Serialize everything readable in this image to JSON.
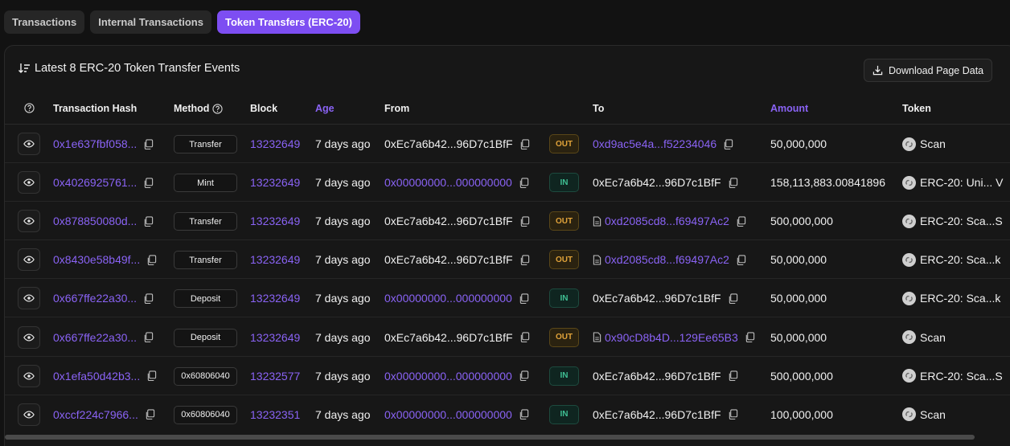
{
  "tabs": [
    {
      "label": "Transactions",
      "active": false
    },
    {
      "label": "Internal Transactions",
      "active": false
    },
    {
      "label": "Token Transfers (ERC-20)",
      "active": true
    }
  ],
  "card": {
    "title": "Latest 8 ERC-20 Token Transfer Events",
    "download_label": "Download Page Data"
  },
  "columns": {
    "tx_hash": "Transaction Hash",
    "method": "Method",
    "block": "Block",
    "age": "Age",
    "from": "From",
    "to": "To",
    "amount": "Amount",
    "token": "Token"
  },
  "rows": [
    {
      "hash": "0x1e637fbf058...",
      "method": "Transfer",
      "block": "13232649",
      "age": "7 days ago",
      "from": "0xEc7a6b42...96D7c1BfF",
      "from_link": false,
      "dir": "OUT",
      "to": "0xd9ac5e4a...f52234046",
      "to_link": true,
      "to_contract": false,
      "amount": "50,000,000",
      "token": "Scan"
    },
    {
      "hash": "0x4026925761...",
      "method": "Mint",
      "block": "13232649",
      "age": "7 days ago",
      "from": "0x00000000...000000000",
      "from_link": true,
      "dir": "IN",
      "to": "0xEc7a6b42...96D7c1BfF",
      "to_link": false,
      "to_contract": false,
      "amount": "158,113,883.00841896",
      "token": "ERC-20: Uni... V"
    },
    {
      "hash": "0x878850080d...",
      "method": "Transfer",
      "block": "13232649",
      "age": "7 days ago",
      "from": "0xEc7a6b42...96D7c1BfF",
      "from_link": false,
      "dir": "OUT",
      "to": "0xd2085cd8...f69497Ac2",
      "to_link": true,
      "to_contract": true,
      "amount": "500,000,000",
      "token": "ERC-20: Sca...S"
    },
    {
      "hash": "0x8430e58b49f...",
      "method": "Transfer",
      "block": "13232649",
      "age": "7 days ago",
      "from": "0xEc7a6b42...96D7c1BfF",
      "from_link": false,
      "dir": "OUT",
      "to": "0xd2085cd8...f69497Ac2",
      "to_link": true,
      "to_contract": true,
      "amount": "50,000,000",
      "token": "ERC-20: Sca...k"
    },
    {
      "hash": "0x667ffe22a30...",
      "method": "Deposit",
      "block": "13232649",
      "age": "7 days ago",
      "from": "0x00000000...000000000",
      "from_link": true,
      "dir": "IN",
      "to": "0xEc7a6b42...96D7c1BfF",
      "to_link": false,
      "to_contract": false,
      "amount": "50,000,000",
      "token": "ERC-20: Sca...k"
    },
    {
      "hash": "0x667ffe22a30...",
      "method": "Deposit",
      "block": "13232649",
      "age": "7 days ago",
      "from": "0xEc7a6b42...96D7c1BfF",
      "from_link": false,
      "dir": "OUT",
      "to": "0x90cD8b4D...129Ee65B3",
      "to_link": true,
      "to_contract": true,
      "amount": "50,000,000",
      "token": "Scan"
    },
    {
      "hash": "0x1efa50d42b3...",
      "method": "0x60806040",
      "block": "13232577",
      "age": "7 days ago",
      "from": "0x00000000...000000000",
      "from_link": true,
      "dir": "IN",
      "to": "0xEc7a6b42...96D7c1BfF",
      "to_link": false,
      "to_contract": false,
      "amount": "500,000,000",
      "token": "ERC-20: Sca...S"
    },
    {
      "hash": "0xccf224c7966...",
      "method": "0x60806040",
      "block": "13232351",
      "age": "7 days ago",
      "from": "0x00000000...000000000",
      "from_link": true,
      "dir": "IN",
      "to": "0xEc7a6b42...96D7c1BfF",
      "to_link": false,
      "to_contract": false,
      "amount": "100,000,000",
      "token": "Scan"
    }
  ],
  "colors": {
    "accent": "#8a63f5",
    "out_badge": "#e1a33a",
    "in_badge": "#3fbf93",
    "background": "#121212"
  },
  "icons": {
    "sort": "sort-descending-icon",
    "download": "download-icon",
    "help": "question-circle-icon",
    "eye": "eye-icon",
    "copy": "copy-icon",
    "contract": "document-icon",
    "token": "token-logo-icon"
  }
}
